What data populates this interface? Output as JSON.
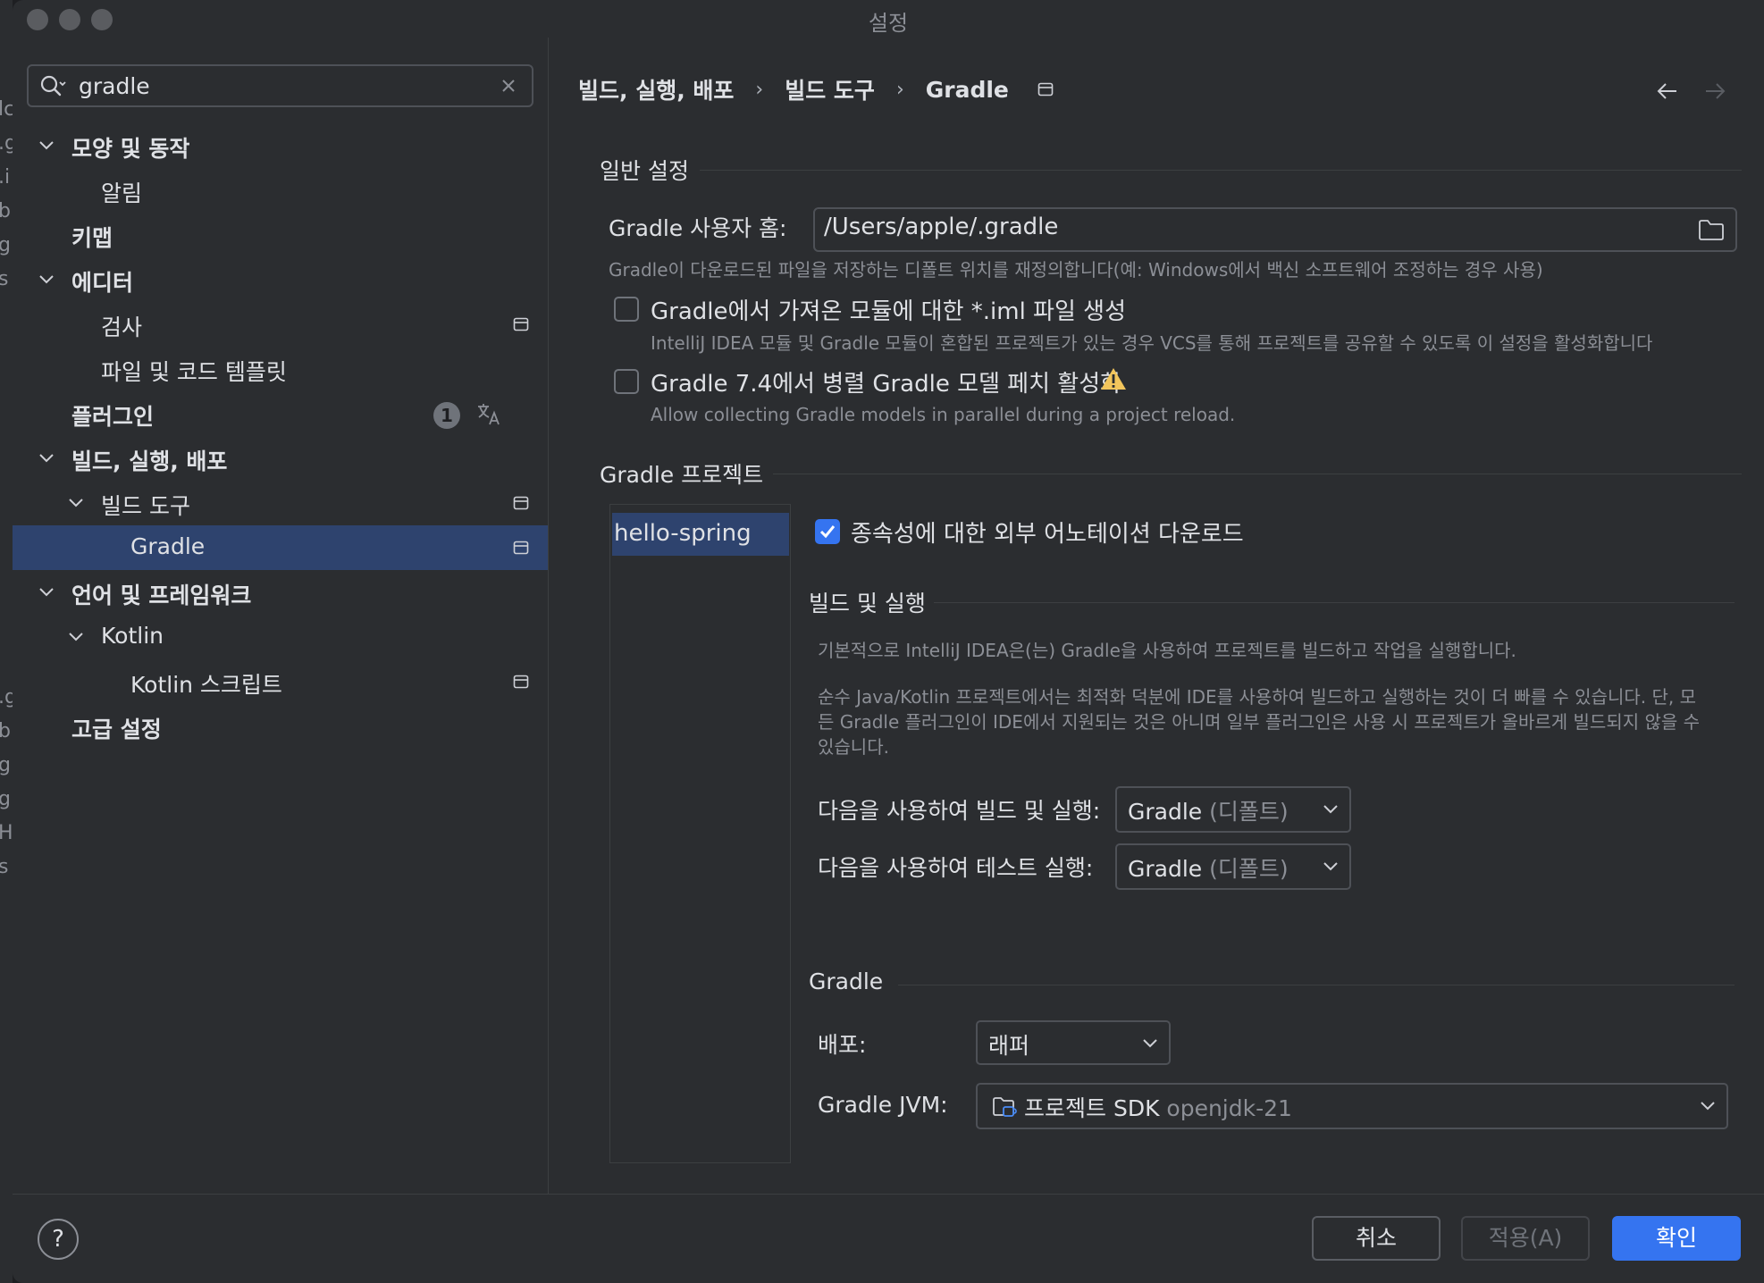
{
  "window": {
    "title": "설정"
  },
  "search": {
    "value": "gradle"
  },
  "tree": [
    {
      "label": "모양 및 동작",
      "level": 0,
      "expanded": true,
      "bold": true
    },
    {
      "label": "알림",
      "level": 1
    },
    {
      "label": "키맵",
      "level": 0,
      "bold": true
    },
    {
      "label": "에디터",
      "level": 0,
      "expanded": true,
      "bold": true
    },
    {
      "label": "검사",
      "level": 1,
      "project_icon": true
    },
    {
      "label": "파일 및 코드 템플릿",
      "level": 1
    },
    {
      "label": "플러그인",
      "level": 0,
      "bold": true,
      "badge": "1",
      "translate": true
    },
    {
      "label": "빌드, 실행, 배포",
      "level": 0,
      "expanded": true,
      "bold": true
    },
    {
      "label": "빌드 도구",
      "level": 1,
      "expanded": true,
      "project_icon": true
    },
    {
      "label": "Gradle",
      "level": 2,
      "selected": true,
      "project_icon": true
    },
    {
      "label": "언어 및 프레임워크",
      "level": 0,
      "expanded": true,
      "bold": true
    },
    {
      "label": "Kotlin",
      "level": 1,
      "expanded": true
    },
    {
      "label": "Kotlin 스크립트",
      "level": 2,
      "project_icon": true
    },
    {
      "label": "고급 설정",
      "level": 0,
      "bold": true
    }
  ],
  "breadcrumb": [
    "빌드, 실행, 배포",
    "빌드 도구",
    "Gradle"
  ],
  "breadcrumb_sep": "›",
  "general": {
    "title": "일반 설정",
    "user_home_label": "Gradle 사용자 홈:",
    "user_home_value": "/Users/apple/.gradle",
    "user_home_hint": "Gradle이 다운로드된 파일을 저장하는 디폴트 위치를 재정의합니다(예: Windows에서 백신 소프트웨어 조정하는 경우 사용)",
    "iml_label": "Gradle에서 가져온 모듈에 대한 *.iml 파일 생성",
    "iml_checked": false,
    "iml_hint": "IntelliJ IDEA 모듈 및 Gradle 모듈이 혼합된 프로젝트가 있는 경우 VCS를 통해 프로젝트를 공유할 수 있도록 이 설정을 활성화합니다",
    "parallel_label": "Gradle 7.4에서 병렬 Gradle 모델 페치 활성화",
    "parallel_checked": false,
    "parallel_hint": "Allow collecting Gradle models in parallel during a project reload."
  },
  "projects": {
    "title": "Gradle 프로젝트",
    "items": [
      "hello-spring"
    ],
    "download_annotations_label": "종속성에 대한 외부 어노테이션 다운로드",
    "download_annotations_checked": true
  },
  "build_run": {
    "title": "빌드 및 실행",
    "desc1": "기본적으로 IntelliJ IDEA은(는) Gradle을 사용하여 프로젝트를 빌드하고 작업을 실행합니다.",
    "desc2_line1": "순수 Java/Kotlin 프로젝트에서는 최적화 덕분에 IDE를 사용하여 빌드하고 실행하는 것이 더 빠를 수 있습니다. 단, 모",
    "desc2_line2": "든 Gradle 플러그인이 IDE에서 지원되는 것은 아니며 일부 플러그인은 사용 시 프로젝트가 올바르게 빌드되지 않을 수",
    "desc2_line3": "있습니다.",
    "build_label": "다음을 사용하여 빌드 및 실행:",
    "build_value": "Gradle",
    "build_suffix": "(디폴트)",
    "test_label": "다음을 사용하여 테스트 실행:",
    "test_value": "Gradle",
    "test_suffix": "(디폴트)"
  },
  "gradle": {
    "title": "Gradle",
    "distribution_label": "배포:",
    "distribution_value": "래퍼",
    "jvm_label": "Gradle JVM:",
    "jvm_value": "프로젝트 SDK",
    "jvm_suffix": "openjdk-21"
  },
  "footer": {
    "help": "?",
    "cancel": "취소",
    "apply": "적용(A)",
    "ok": "확인"
  },
  "colors": {
    "accent": "#3574f0",
    "selection": "#2e436e",
    "warning": "#f2c55c"
  }
}
